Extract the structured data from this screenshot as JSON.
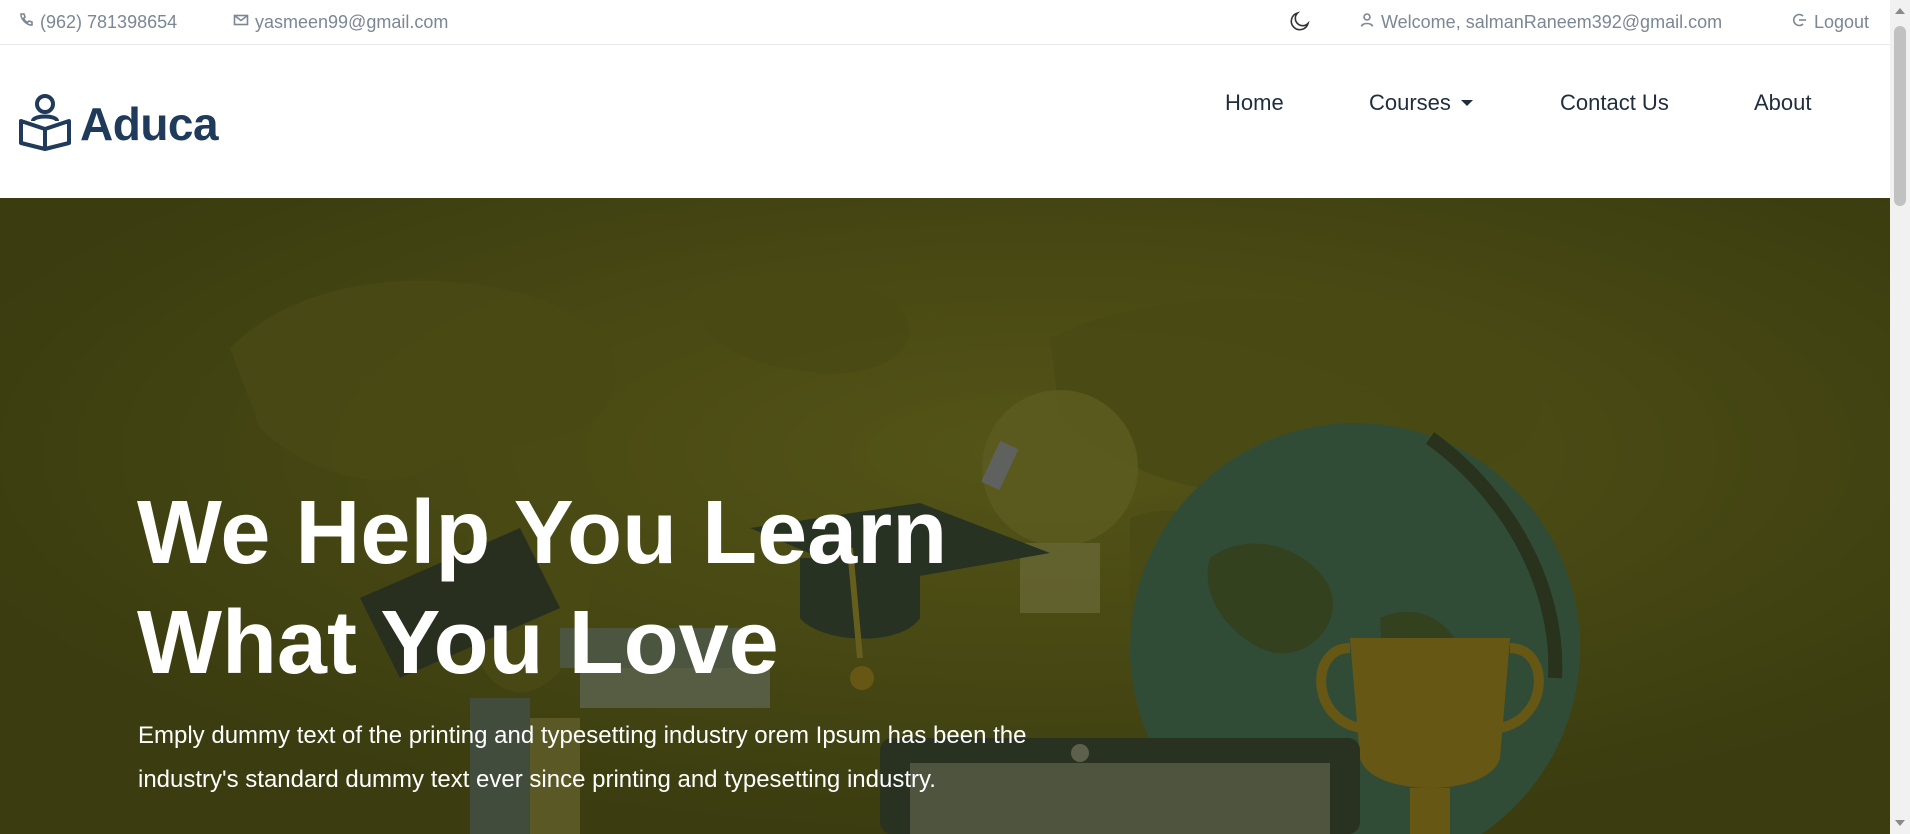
{
  "topbar": {
    "phone": "(962) 781398654",
    "email": "yasmeen99@gmail.com",
    "theme_icon": "moon-icon",
    "welcome": "Welcome, salmanRaneem392@gmail.com",
    "logout": "Logout"
  },
  "brand": {
    "name": "Aduca",
    "icon": "reader-book-icon"
  },
  "nav": {
    "home": "Home",
    "courses": "Courses",
    "contact": "Contact Us",
    "about": "About"
  },
  "hero": {
    "title_line1": "We Help You Learn",
    "title_line2": "What You Love",
    "subtitle_line1": "Emply dummy text of the printing and typesetting industry orem Ipsum has been the",
    "subtitle_line2": "industry's standard dummy text ever since printing and typesetting industry."
  },
  "colors": {
    "hero_tint": "#45461a",
    "brand": "#1f3a5a",
    "muted": "#7b8794"
  }
}
